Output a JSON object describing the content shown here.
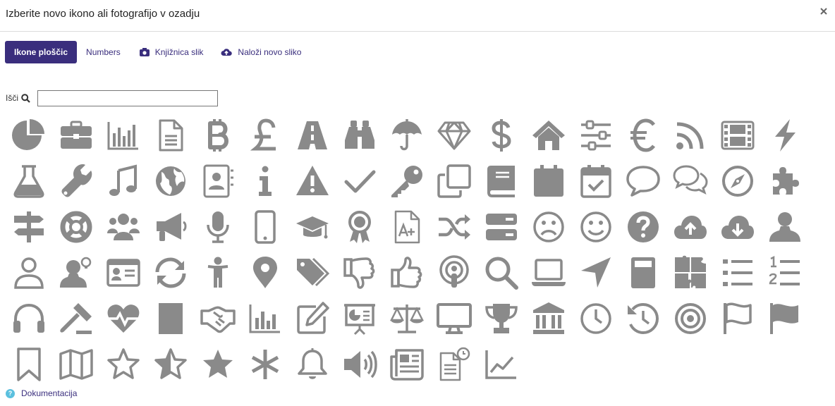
{
  "dialog": {
    "title": "Izberite novo ikono ali fotografijo v ozadju",
    "close_icon": "close-icon"
  },
  "tabs": [
    {
      "label": "Ikone ploščic",
      "active": true
    },
    {
      "label": "Numbers",
      "active": false
    },
    {
      "label": "Knjižnica slik",
      "icon": "camera-icon",
      "active": false
    },
    {
      "label": "Naloži novo sliko",
      "icon": "cloud-upload-icon",
      "active": false
    }
  ],
  "search": {
    "label": "Išči",
    "icon": "search-icon",
    "value": "",
    "placeholder": ""
  },
  "icons": [
    "pie-chart-icon",
    "briefcase-icon",
    "bar-chart-icon",
    "file-text-icon",
    "bitcoin-icon",
    "pound-icon",
    "road-icon",
    "binoculars-icon",
    "umbrella-icon",
    "diamond-icon",
    "dollar-icon",
    "home-icon",
    "sliders-icon",
    "euro-icon",
    "rss-icon",
    "film-icon",
    "bolt-icon",
    "flask-icon",
    "wrench-icon",
    "music-icon",
    "globe-icon",
    "address-book-icon",
    "info-icon",
    "warning-icon",
    "check-icon",
    "key-icon",
    "clone-icon",
    "book-icon",
    "calendar-icon",
    "calendar-check-icon",
    "comment-icon",
    "comments-icon",
    "compass-icon",
    "puzzle-icon",
    "signpost-icon",
    "life-ring-icon",
    "users-icon",
    "bullhorn-icon",
    "microphone-icon",
    "mobile-icon",
    "graduation-cap-icon",
    "award-icon",
    "file-grade-icon",
    "random-icon",
    "server-icon",
    "frown-icon",
    "smile-icon",
    "question-circle-icon",
    "cloud-upload-icon",
    "cloud-download-icon",
    "user-icon",
    "user-outline-icon",
    "user-idea-icon",
    "id-card-icon",
    "sync-icon",
    "child-icon",
    "map-marker-icon",
    "tags-icon",
    "thumbs-down-icon",
    "thumbs-up-icon",
    "podcast-icon",
    "search-icon",
    "laptop-icon",
    "location-arrow-icon",
    "calculator-icon",
    "puzzle-pieces-icon",
    "list-icon",
    "list-ordered-icon",
    "headphones-icon",
    "gavel-icon",
    "heartbeat-icon",
    "building-icon",
    "handshake-icon",
    "chart-bar-outline-icon",
    "edit-icon",
    "presentation-icon",
    "balance-scale-icon",
    "desktop-icon",
    "trophy-icon",
    "university-icon",
    "clock-icon",
    "history-icon",
    "bullseye-icon",
    "flag-icon",
    "flag-checkered-icon",
    "bookmark-icon",
    "map-icon",
    "star-outline-icon",
    "star-half-icon",
    "star-icon",
    "asterisk-icon",
    "bell-icon",
    "volume-up-icon",
    "newspaper-icon",
    "file-clock-icon",
    "line-chart-icon",
    "lightbulb-icon"
  ],
  "footer": {
    "doc_label": "Dokumentacija",
    "doc_icon": "help-icon",
    "doc_icon_glyph": "?"
  },
  "colors": {
    "accent": "#3a2e7d",
    "icon": "#8a8a8a",
    "help": "#5bc0de"
  }
}
